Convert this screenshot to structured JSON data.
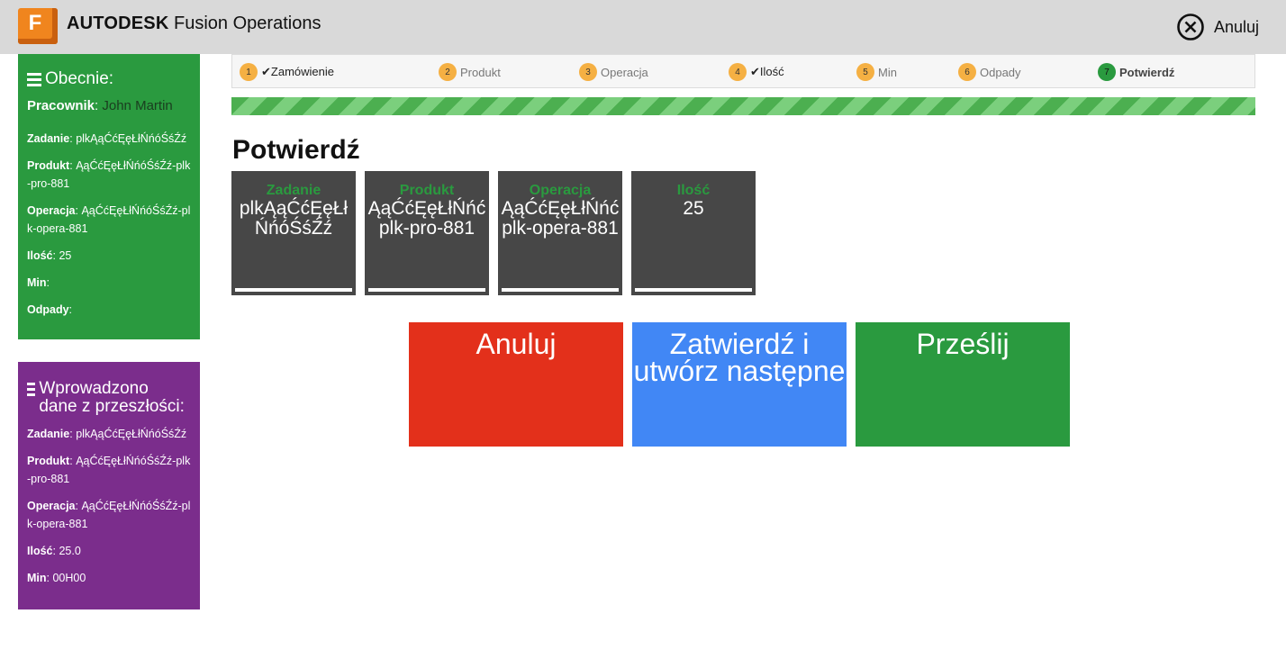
{
  "header": {
    "logo_letter": "F",
    "brand_bold": "AUTODESK",
    "brand_rest": " Fusion Operations",
    "cancel_label": "Anuluj"
  },
  "current_panel": {
    "title": "Obecnie:",
    "worker_label": "Pracownik",
    "worker_name": "John Martin",
    "rows": [
      {
        "label": "Zadanie",
        "value": "plkĄąĆćĘęŁłŃńóŚśŹź"
      },
      {
        "label": "Produkt",
        "value": "ĄąĆćĘęŁłŃńóŚśŹź-plk-pro-881"
      },
      {
        "label": "Operacja",
        "value": "ĄąĆćĘęŁłŃńóŚśŹź-plk-opera-881"
      },
      {
        "label": "Ilość",
        "value": "25"
      },
      {
        "label": "Min",
        "value": ""
      },
      {
        "label": "Odpady",
        "value": ""
      }
    ]
  },
  "past_panel": {
    "title": "Wprowadzono dane z przeszłości:",
    "rows": [
      {
        "label": "Zadanie",
        "value": "plkĄąĆćĘęŁłŃńóŚśŹź"
      },
      {
        "label": "Produkt",
        "value": "ĄąĆćĘęŁłŃńóŚśŹź-plk-pro-881"
      },
      {
        "label": "Operacja",
        "value": "ĄąĆćĘęŁłŃńóŚśŹź-plk-opera-881"
      },
      {
        "label": "Ilość",
        "value": "25.0"
      },
      {
        "label": "Min",
        "value": "00H00"
      }
    ]
  },
  "steps": [
    {
      "num": "1",
      "label": "Zamówienie",
      "check": "✔"
    },
    {
      "num": "2",
      "label": "Produkt",
      "check": ""
    },
    {
      "num": "3",
      "label": "Operacja",
      "check": ""
    },
    {
      "num": "4",
      "label": "Ilość",
      "check": "✔"
    },
    {
      "num": "5",
      "label": "Min",
      "check": ""
    },
    {
      "num": "6",
      "label": "Odpady",
      "check": ""
    },
    {
      "num": "7",
      "label": "Potwierdź",
      "check": ""
    }
  ],
  "progress_percent": 100,
  "page_title": "Potwierdź",
  "cards": [
    {
      "title": "Zadanie",
      "value": "plkĄąĆćĘęŁłŃńóŚśŹź"
    },
    {
      "title": "Produkt",
      "value": "ĄąĆćĘęŁłŃńć plk-pro-881"
    },
    {
      "title": "Operacja",
      "value": "ĄąĆćĘęŁłŃńć plk-opera-881"
    },
    {
      "title": "Ilość",
      "value": "25"
    }
  ],
  "buttons": {
    "cancel": "Anuluj",
    "confirm_next": "Zatwierdź i utwórz następne",
    "submit": "Prześlij"
  }
}
